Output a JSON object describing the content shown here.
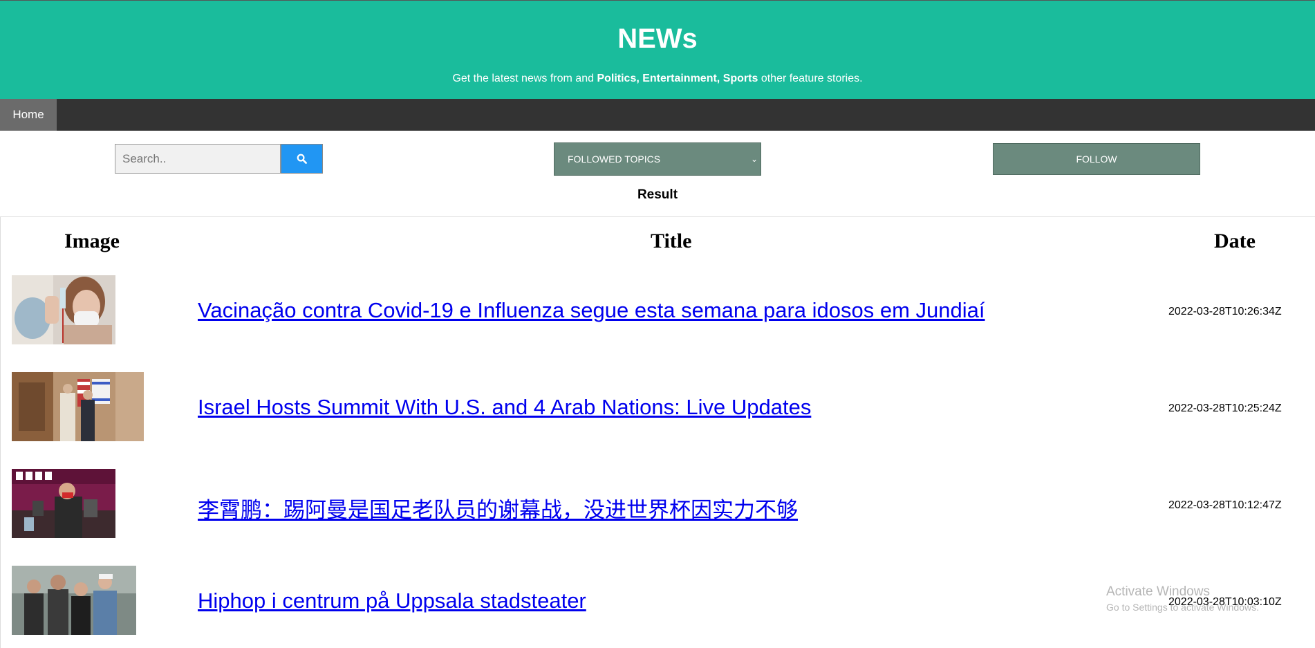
{
  "header": {
    "title": "NEWs",
    "tagline_prefix": "Get the latest news from and ",
    "tagline_bold": "Politics, Entertainment, Sports",
    "tagline_suffix": " other feature stories.",
    "background_color": "#1abc9c"
  },
  "nav": {
    "items": [
      {
        "label": "Home",
        "active": true
      }
    ]
  },
  "controls": {
    "search_placeholder": "Search..",
    "search_icon": "search-icon",
    "topics_select_value": "FOLLOWED TOPICS",
    "follow_label": "FOLLOW"
  },
  "result_label": "Result",
  "table": {
    "columns": [
      "Image",
      "Title",
      "Date"
    ],
    "rows": [
      {
        "image": "covid-vaccination-photo",
        "title": "Vacinação contra Covid-19 e Influenza segue esta semana para idosos em Jundiaí",
        "date": "2022-03-28T10:26:34Z"
      },
      {
        "image": "israel-summit-photo",
        "title": "Israel Hosts Summit With U.S. and 4 Arab Nations: Live Updates",
        "date": "2022-03-28T10:25:24Z"
      },
      {
        "image": "press-conference-photo",
        "title": "李霄鹏：踢阿曼是国足老队员的谢幕战，没进世界杯因实力不够",
        "date": "2022-03-28T10:12:47Z"
      },
      {
        "image": "hiphop-group-photo",
        "title": "Hiphop i centrum på Uppsala stadsteater",
        "date": "2022-03-28T10:03:10Z"
      }
    ]
  },
  "watermark": {
    "line1": "Activate Windows",
    "line2": "Go to Settings to activate Windows."
  }
}
